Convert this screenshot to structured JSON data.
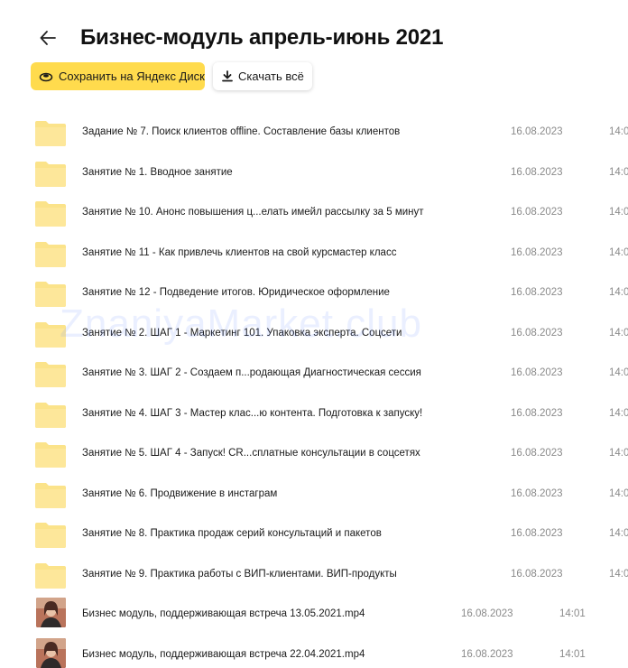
{
  "header": {
    "back_icon": "arrow-left-icon",
    "title": "Бизнес-модуль апрель-июнь 2021"
  },
  "toolbar": {
    "save_label": "Сохранить на Яндекс Диск",
    "save_icon": "disk-icon",
    "download_label": "Скачать всё",
    "download_icon": "download-icon"
  },
  "colors": {
    "accent": "#ffdb4d",
    "folder": "#fbe38a",
    "muted_text": "#8a8a8a"
  },
  "files": [
    {
      "name": "Задание № 7. Поиск клиентов offline. Составление базы клиентов",
      "date": "16.08.2023",
      "time": "14:0",
      "type": "folder"
    },
    {
      "name": "Занятие № 1. Вводное занятие",
      "date": "16.08.2023",
      "time": "14:0",
      "type": "folder"
    },
    {
      "name": "Занятие № 10. Анонс повышения ц...елать имейл рассылку за 5 минут",
      "date": "16.08.2023",
      "time": "14:0",
      "type": "folder"
    },
    {
      "name": "Занятие № 11 - Как привлечь клиентов на свой курсмастер класс",
      "date": "16.08.2023",
      "time": "14:0",
      "type": "folder"
    },
    {
      "name": "Занятие № 12 - Подведение итогов. Юридическое оформление",
      "date": "16.08.2023",
      "time": "14:0",
      "type": "folder"
    },
    {
      "name": "Занятие № 2. ШАГ 1 - Маркетинг 101. Упаковка эксперта. Соцсети",
      "date": "16.08.2023",
      "time": "14:0",
      "type": "folder"
    },
    {
      "name": "Занятие № 3. ШАГ 2 - Создаем п...родающая Диагностическая сессия",
      "date": "16.08.2023",
      "time": "14:0",
      "type": "folder"
    },
    {
      "name": "Занятие № 4. ШАГ 3 - Мастер клас...ю контента. Подготовка к запуску!",
      "date": "16.08.2023",
      "time": "14:0",
      "type": "folder"
    },
    {
      "name": "Занятие № 5. ШАГ 4 - Запуск! CR...сплатные консультации в соцсетях",
      "date": "16.08.2023",
      "time": "14:0",
      "type": "folder"
    },
    {
      "name": "Занятие № 6. Продвижение в инстаграм",
      "date": "16.08.2023",
      "time": "14:0",
      "type": "folder"
    },
    {
      "name": "Занятие № 8. Практика продаж серий консультаций и пакетов",
      "date": "16.08.2023",
      "time": "14:0",
      "type": "folder"
    },
    {
      "name": "Занятие № 9. Практика работы с ВИП-клиентами. ВИП-продукты",
      "date": "16.08.2023",
      "time": "14:0",
      "type": "folder"
    },
    {
      "name": "Бизнес модуль, поддерживающая встреча 13.05.2021.mp4",
      "date": "16.08.2023",
      "time": "14:01",
      "type": "video"
    },
    {
      "name": "Бизнес модуль, поддерживающая встреча 22.04.2021.mp4",
      "date": "16.08.2023",
      "time": "14:01",
      "type": "video"
    }
  ],
  "watermark": "ZnaniyaMarket.club"
}
